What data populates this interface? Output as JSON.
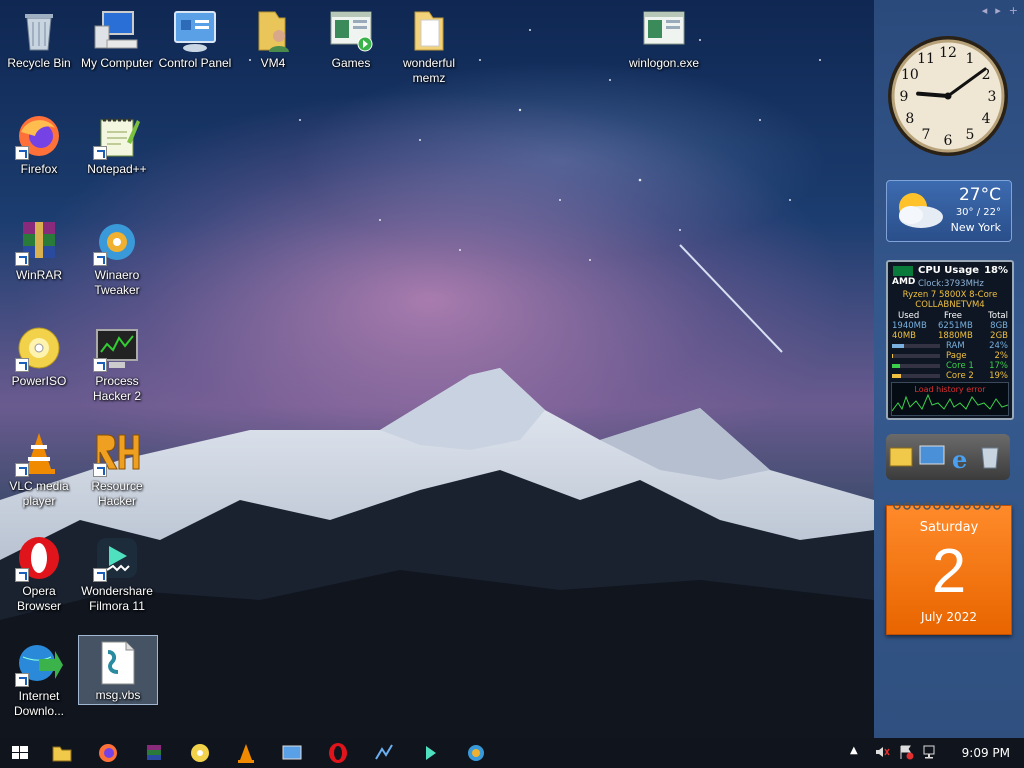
{
  "desktop_icons": [
    {
      "id": "recycle-bin",
      "label": "Recycle Bin"
    },
    {
      "id": "my-computer",
      "label": "My Computer"
    },
    {
      "id": "control-panel",
      "label": "Control Panel"
    },
    {
      "id": "vm4",
      "label": "VM4"
    },
    {
      "id": "games",
      "label": "Games"
    },
    {
      "id": "wonderful-memz",
      "label": "wonderful memz"
    },
    {
      "id": "winlogon",
      "label": "winlogon.exe"
    },
    {
      "id": "firefox",
      "label": "Firefox"
    },
    {
      "id": "notepadpp",
      "label": "Notepad++"
    },
    {
      "id": "winrar",
      "label": "WinRAR"
    },
    {
      "id": "winaero",
      "label": "Winaero Tweaker"
    },
    {
      "id": "poweriso",
      "label": "PowerISO"
    },
    {
      "id": "process-hacker",
      "label": "Process Hacker 2"
    },
    {
      "id": "vlc",
      "label": "VLC media player"
    },
    {
      "id": "resource-hacker",
      "label": "Resource Hacker"
    },
    {
      "id": "opera",
      "label": "Opera Browser"
    },
    {
      "id": "filmora",
      "label": "Wondershare Filmora 11"
    },
    {
      "id": "idm",
      "label": "Internet Downlo..."
    },
    {
      "id": "msg-vbs",
      "label": "msg.vbs"
    }
  ],
  "gadgets": {
    "clock": {
      "hour": 9,
      "minute": 9,
      "numerals": [
        "12",
        "1",
        "2",
        "3",
        "4",
        "5",
        "6",
        "7",
        "8",
        "9",
        "10",
        "11"
      ]
    },
    "weather": {
      "temp": "27°C",
      "range": "30° / 22°",
      "city": "New York"
    },
    "cpu": {
      "brand": "AMD",
      "title": "CPU Usage",
      "usage": "18%",
      "clock": "Clock:3793MHz",
      "model": "Ryzen 7 5800X 8-Core",
      "host": "COLLABNETVM4",
      "headers": {
        "used": "Used",
        "free": "Free",
        "total": "Total"
      },
      "mem_rows": [
        {
          "used": "1940MB",
          "free": "6251MB",
          "total": "8GB"
        },
        {
          "used": "40MB",
          "free": "1880MB",
          "total": "2GB"
        }
      ],
      "meters": [
        {
          "label": "RAM",
          "value": "24%",
          "fraction": 0.24
        },
        {
          "label": "Page",
          "value": "2%",
          "fraction": 0.02
        },
        {
          "label": "Core 1",
          "value": "17%",
          "fraction": 0.17
        },
        {
          "label": "Core 2",
          "value": "19%",
          "fraction": 0.19
        }
      ],
      "error": "Load history error"
    },
    "calendar": {
      "day": "Saturday",
      "date": "2",
      "month": "July 2022"
    }
  },
  "taskbar": {
    "items": [
      "start",
      "file-explorer",
      "firefox",
      "winrar",
      "poweriso",
      "vlc",
      "control-panel",
      "opera",
      "process-hacker",
      "filmora",
      "winaero"
    ],
    "time": "9:09 PM"
  }
}
